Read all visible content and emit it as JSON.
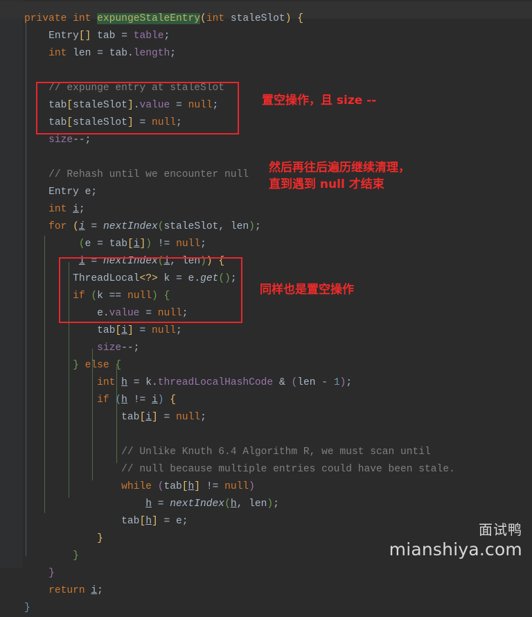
{
  "editor": {
    "theme": "darcula",
    "background": "#2b2b2b",
    "current_line_background": "#323232",
    "default_text_color": "#a9b7c6",
    "search_highlight_color": "#32593d",
    "annotation_color": "#ef2b2b"
  },
  "code": {
    "language": "java",
    "search_term": "expungeStaleEntry",
    "lines": [
      "    private int expungeStaleEntry(int staleSlot) {",
      "        Entry[] tab = table;",
      "        int len = tab.length;",
      "",
      "        // expunge entry at staleSlot",
      "        tab[staleSlot].value = null;",
      "        tab[staleSlot] = null;",
      "        size--;",
      "",
      "        // Rehash until we encounter null",
      "        Entry e;",
      "        int i;",
      "        for (i = nextIndex(staleSlot, len);",
      "             (e = tab[i]) != null;",
      "             i = nextIndex(i, len)) {",
      "            ThreadLocal<?> k = e.get();",
      "            if (k == null) {",
      "                e.value = null;",
      "                tab[i] = null;",
      "                size--;",
      "            } else {",
      "                int h = k.threadLocalHashCode & (len - 1);",
      "                if (h != i) {",
      "                    tab[i] = null;",
      "",
      "                    // Unlike Knuth 6.4 Algorithm R, we must scan until",
      "                    // null because multiple entries could have been stale.",
      "                    while (tab[h] != null)",
      "                        h = nextIndex(h, len);",
      "                    tab[h] = e;",
      "                }",
      "            }",
      "        }",
      "        return i;",
      "    }"
    ]
  },
  "annotations": [
    {
      "id": "note-1",
      "text": "置空操作，且 size --",
      "target": "tab[staleSlot].value = null; / tab[staleSlot] = null; / size--;"
    },
    {
      "id": "note-2",
      "line1": "然后再往后遍历继续清理，",
      "line2": "直到遇到 null 才结束",
      "target": "for loop rehash block"
    },
    {
      "id": "note-3",
      "text": "同样也是置空操作",
      "target": "if (k == null) { ... } block"
    }
  ],
  "highlight_boxes": [
    {
      "id": "box-1",
      "label": "expunge-entry-block"
    },
    {
      "id": "box-2",
      "label": "null-out-stale-entry-block"
    }
  ],
  "watermark": {
    "chinese": "面试鸭",
    "site": "mianshiya.com"
  }
}
